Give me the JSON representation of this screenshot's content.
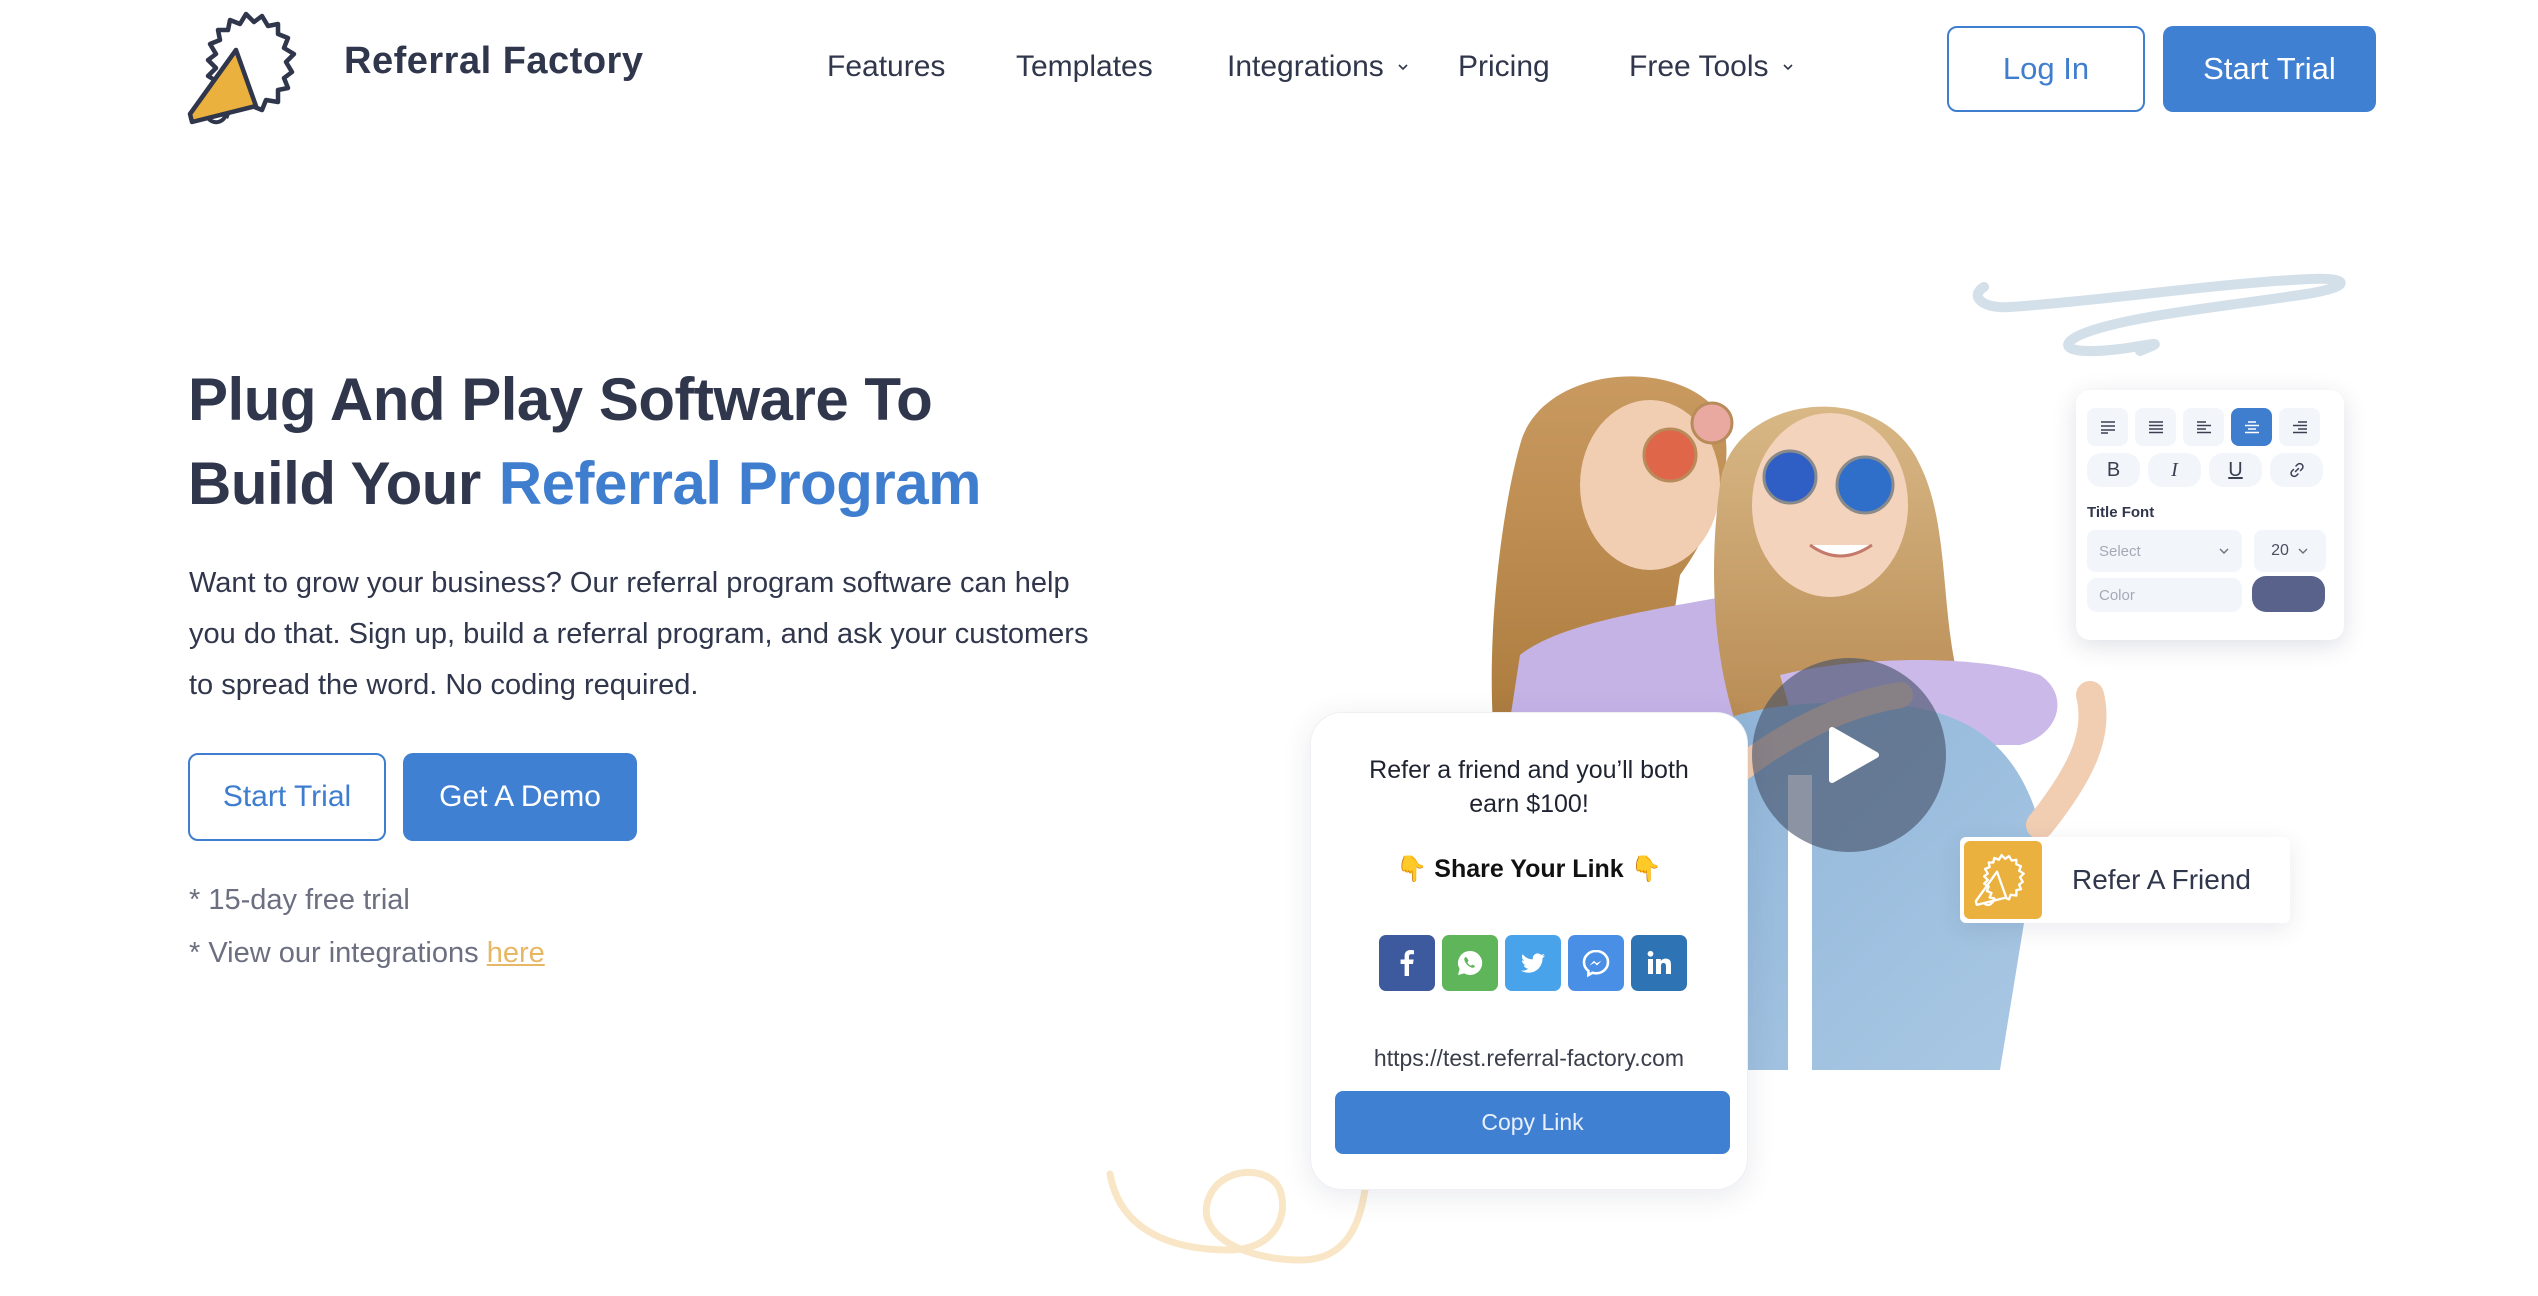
{
  "header": {
    "brand": "Referral Factory",
    "nav": [
      {
        "label": "Features",
        "dropdown": false
      },
      {
        "label": "Templates",
        "dropdown": false
      },
      {
        "label": "Integrations",
        "dropdown": true
      },
      {
        "label": "Pricing",
        "dropdown": false
      },
      {
        "label": "Free Tools",
        "dropdown": true
      }
    ],
    "login_label": "Log In",
    "start_trial_label": "Start Trial"
  },
  "hero": {
    "title_line1": "Plug And Play Software To",
    "title_line2_plain": "Build Your",
    "title_line2_accent": "Referral Program",
    "description": "Want to grow your business? Our referral program software can help you do that. Sign up, build a referral program, and ask your customers to spread the word. No coding required.",
    "start_trial_label": "Start Trial",
    "demo_label": "Get A Demo",
    "note_trial": "* 15-day free trial",
    "note_integrations_prefix": "* View our integrations ",
    "note_integrations_link": "here"
  },
  "widget": {
    "card_title": "Refer a friend and you’ll both earn $100!",
    "share_hand": "👇",
    "share_label": "Share Your Link",
    "socials": [
      {
        "name": "facebook",
        "icon": "facebook-icon",
        "color": "#3d5a9e"
      },
      {
        "name": "whatsapp",
        "icon": "whatsapp-icon",
        "color": "#5fb55a"
      },
      {
        "name": "twitter",
        "icon": "twitter-icon",
        "color": "#48a3ea"
      },
      {
        "name": "messenger",
        "icon": "messenger-icon",
        "color": "#4a8fe6"
      },
      {
        "name": "linkedin",
        "icon": "linkedin-icon",
        "color": "#2e73b3"
      }
    ],
    "url": "https://test.referral-factory.com",
    "copy_label": "Copy Link",
    "refer_chip_label": "Refer A Friend"
  },
  "editor": {
    "align_active_index": 3,
    "title_font_label": "Title Font",
    "font_select_placeholder": "Select",
    "size_value": "20",
    "color_placeholder": "Color",
    "swatch_color": "#58628b"
  },
  "colors": {
    "brand_blue": "#4080d2",
    "dark_text": "#30364b",
    "accent_yellow": "#ebb13f"
  }
}
